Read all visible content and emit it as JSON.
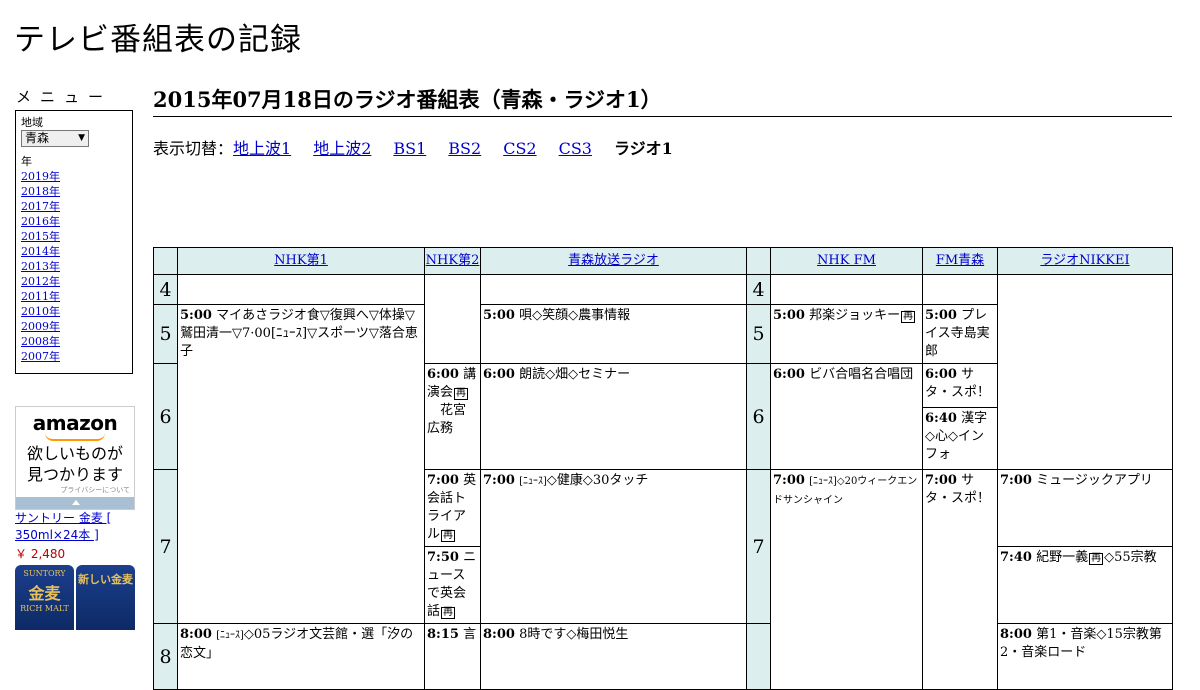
{
  "site_title": "テレビ番組表の記録",
  "menu": {
    "title": "メニュー",
    "region_label": "地域",
    "region_value": "青森",
    "region_arrow": "▼",
    "year_label": "年",
    "years": [
      "2019年",
      "2018年",
      "2017年",
      "2016年",
      "2015年",
      "2014年",
      "2013年",
      "2012年",
      "2011年",
      "2010年",
      "2009年",
      "2008年",
      "2007年"
    ]
  },
  "ad": {
    "logo": "amazon",
    "tagline_1": "欲しいものが",
    "tagline_2": "見つかります",
    "privacy": "プライバシーについて",
    "product": "サントリー 金麦 [ 350ml×24本 ]",
    "price": "￥ 2,480",
    "can_brand": "SUNTORY",
    "can_left": "金麦",
    "can_left_sub": "RICH MALT",
    "can_right": "新しい金麦"
  },
  "heading": "2015年07月18日のラジオ番組表（青森・ラジオ1）",
  "switcher": {
    "prefix": "表示切替：",
    "links": [
      "地上波1",
      "地上波2",
      "BS1",
      "BS2",
      "CS2",
      "CS3"
    ],
    "current": "ラジオ1"
  },
  "channels": [
    "NHK第1",
    "NHK第2",
    "青森放送ラジオ",
    "NHK FM",
    "FM青森",
    "ラジオNIKKEI"
  ],
  "hours": [
    "4",
    "5",
    "6",
    "7",
    "8"
  ],
  "programs": {
    "nhk1_500_t": "5:00",
    "nhk1_500": "マイあさラジオ食▽復興へ▽体操▽鷲田清一▽7·00[ﾆｭｰｽ]▽スポーツ▽落合恵子",
    "nhk1_800_t": "8:00",
    "nhk1_800_news": "[ﾆｭｰｽ]",
    "nhk1_800": "◇05ラジオ文芸館・選「汐の恋文」",
    "nhk2_600_t": "6:00",
    "nhk2_600": "講演会",
    "nhk2_600_b": "花宮広務",
    "nhk2_700_t": "7:00",
    "nhk2_700": "英会話トライアル",
    "nhk2_750_t": "7:50",
    "nhk2_750": "ニュースで英会話",
    "nhk2_815_t": "8:15",
    "nhk2_815": "言",
    "rab_500_t": "5:00",
    "rab_500": "唄◇笑顔◇農事情報",
    "rab_600_t": "6:00",
    "rab_600": "朗読◇畑◇セミナー",
    "rab_700_t": "7:00",
    "rab_700_news": "[ﾆｭｰｽ]",
    "rab_700": "◇健康◇30タッチ",
    "rab_800_t": "8:00",
    "rab_800": "8時です◇梅田悦生",
    "fm_500_t": "5:00",
    "fm_500": "邦楽ジョッキー",
    "fm_600_t": "6:00",
    "fm_600": "ビバ合唱名合唱団",
    "fm_700_t": "7:00",
    "fm_700_news": "[ﾆｭｰｽ]",
    "fm_700": "◇20ウィークエンドサンシャイン",
    "afm_500_t": "5:00",
    "afm_500": "プレイス寺島実郎",
    "afm_600_t": "6:00",
    "afm_600": "サタ・スポ！",
    "afm_640_t": "6:40",
    "afm_640": "漢字◇心◇インフォ",
    "afm_700_t": "7:00",
    "afm_700": "サタ・スポ！",
    "nikkei_700_t": "7:00",
    "nikkei_700": "ミュージックアプリ",
    "nikkei_740_t": "7:40",
    "nikkei_740": "紀野一義",
    "nikkei_740_b": "◇55宗教",
    "nikkei_800_t": "8:00",
    "nikkei_800": "第1・音楽◇15宗教第2・音楽ロード"
  },
  "rebroadcast_mark": "再"
}
